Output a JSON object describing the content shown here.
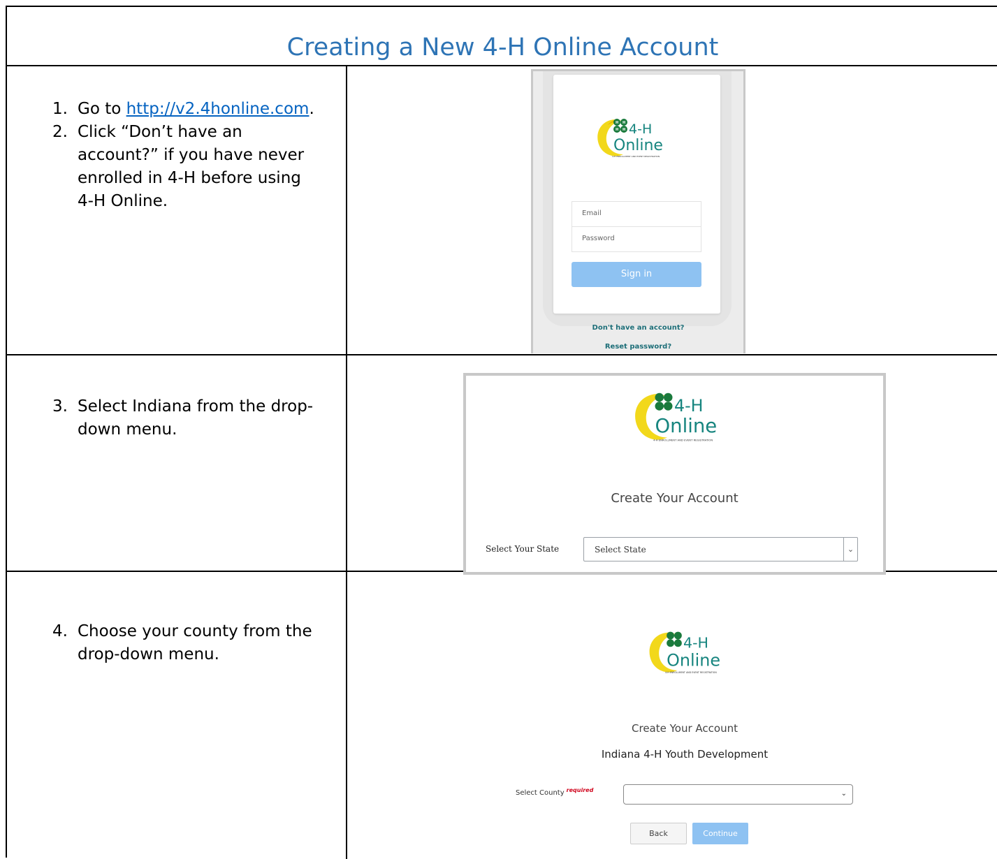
{
  "document": {
    "title": "Creating a New 4-H Online Account"
  },
  "steps": [
    {
      "num": "1.",
      "pre": "Go to ",
      "link": "http://v2.4honline.com",
      "post": "."
    },
    {
      "num": "2.",
      "text": "Click “Don’t have an account?” if you have never enrolled in 4-H before using 4-H Online."
    },
    {
      "num": "3.",
      "text": "Select Indiana from the drop-down menu."
    },
    {
      "num": "4.",
      "text": "Choose your county from the drop-down menu."
    }
  ],
  "logo": {
    "line1": "4-H",
    "line2": "Online",
    "tagline": "4-H ENROLLMENT AND EVENT REGISTRATION",
    "brand_green": "#1a7a3c",
    "brand_teal": "#17857f",
    "brand_yellow": "#f2d81b"
  },
  "signin_screen": {
    "email_placeholder": "Email",
    "password_placeholder": "Password",
    "signin_label": "Sign in",
    "no_account_link": "Don't have an account?",
    "reset_link": "Reset password?"
  },
  "state_screen": {
    "heading": "Create Your Account",
    "state_label": "Select Your State",
    "state_select_value": "Select State"
  },
  "county_screen": {
    "heading": "Create Your Account",
    "org": "Indiana 4-H Youth Development",
    "county_label": "Select County",
    "required": "required",
    "county_select_value": "",
    "back_label": "Back",
    "continue_label": "Continue"
  },
  "colors": {
    "title_blue": "#2e74b5",
    "link_blue": "#0563c1",
    "button_blue": "#8ec2f2",
    "required_red": "#d0021b"
  }
}
